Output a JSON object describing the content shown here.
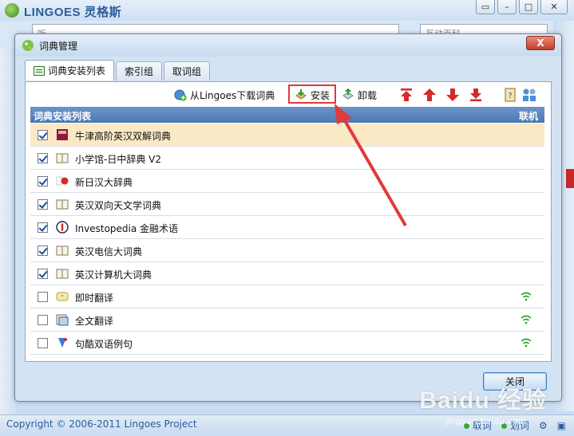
{
  "app": {
    "title": "LINGOES 灵格斯",
    "search_placeholder": "互动百科",
    "left_input": "听",
    "copyright": "Copyright © 2006-2011 Lingoes Project",
    "status_items": [
      "取词",
      "划词"
    ],
    "watermark": "Baidu 经验",
    "watermark_sub": "jingyan.baidu.com"
  },
  "dialog": {
    "title": "词典管理",
    "close_label": "X",
    "tabs": [
      {
        "label": "词典安装列表",
        "active": true
      },
      {
        "label": "索引组",
        "active": false
      },
      {
        "label": "取词组",
        "active": false
      }
    ],
    "toolbar": {
      "download_label": "从Lingoes下载词典",
      "install_label": "安装",
      "uninstall_label": "卸载"
    },
    "list_header": {
      "left": "词典安装列表",
      "right": "联机"
    },
    "rows": [
      {
        "name": "牛津高阶英汉双解词典",
        "checked": true,
        "online": false,
        "selected": true,
        "icon": "oxford-icon"
      },
      {
        "name": "小学馆-日中辞典  V2",
        "checked": true,
        "online": false,
        "selected": false,
        "icon": "book-icon"
      },
      {
        "name": "新日汉大辞典",
        "checked": true,
        "online": false,
        "selected": false,
        "icon": "japan-flag-icon"
      },
      {
        "name": "英汉双向天文学词典",
        "checked": true,
        "online": false,
        "selected": false,
        "icon": "book-icon"
      },
      {
        "name": "Investopedia 金融术语",
        "checked": true,
        "online": false,
        "selected": false,
        "icon": "investopedia-icon"
      },
      {
        "name": "英汉电信大词典",
        "checked": true,
        "online": false,
        "selected": false,
        "icon": "book-icon"
      },
      {
        "name": "英汉计算机大词典",
        "checked": true,
        "online": false,
        "selected": false,
        "icon": "book-icon"
      },
      {
        "name": "即时翻译",
        "checked": false,
        "online": true,
        "selected": false,
        "icon": "instant-translate-icon"
      },
      {
        "name": "全文翻译",
        "checked": false,
        "online": true,
        "selected": false,
        "icon": "fulltext-translate-icon"
      },
      {
        "name": "句酷双语例句",
        "checked": false,
        "online": true,
        "selected": false,
        "icon": "jukuu-icon"
      }
    ],
    "ok_label": "关闭"
  },
  "colors": {
    "header_blue": "#4a78b3",
    "selected_row": "#fbe9c6",
    "highlight_red": "#e03a3a",
    "online_green": "#2fa42f"
  }
}
